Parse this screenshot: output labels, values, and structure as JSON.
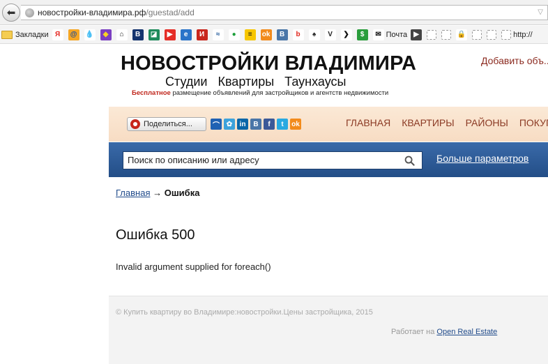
{
  "browser": {
    "url_host": "новостройки-владимира.рф",
    "url_path": "/guestad/add"
  },
  "bookmarks": {
    "folder_label": "Закладки",
    "mail_label": "Почта",
    "last_label": "http://",
    "favicons": [
      {
        "icon": "yandex-icon",
        "glyph": "Я",
        "color": "#ffffff",
        "fg": "#e52620"
      },
      {
        "icon": "mailru-icon",
        "glyph": "@",
        "color": "#f5a623",
        "fg": "#1a4c9c"
      },
      {
        "icon": "drop-icon",
        "glyph": "💧",
        "color": "#ffffff",
        "fg": "#2a7bd6"
      },
      {
        "icon": "rainbow-icon",
        "glyph": "◆",
        "color": "#7b3fc2",
        "fg": "#f9d423"
      },
      {
        "icon": "home-icon",
        "glyph": "⌂",
        "color": "#ffffff",
        "fg": "#111111"
      },
      {
        "icon": "bill-icon",
        "glyph": "B",
        "color": "#14346e",
        "fg": "#ffffff"
      },
      {
        "icon": "green-square-icon",
        "glyph": "◪",
        "color": "#1f8b5c",
        "fg": "#ffffff"
      },
      {
        "icon": "youtube-icon",
        "glyph": "▶",
        "color": "#e52d27",
        "fg": "#ffffff"
      },
      {
        "icon": "blue-app-icon",
        "glyph": "e",
        "color": "#2a74c9",
        "fg": "#ffffff"
      },
      {
        "icon": "red-app-icon",
        "glyph": "И",
        "color": "#c9261d",
        "fg": "#ffffff"
      },
      {
        "icon": "bank-icon",
        "glyph": "≈",
        "color": "#ffffff",
        "fg": "#245c9c"
      },
      {
        "icon": "sberbank-icon",
        "glyph": "●",
        "color": "#ffffff",
        "fg": "#1d9f3b"
      },
      {
        "icon": "beeline-icon",
        "glyph": "≡",
        "color": "#f7c600",
        "fg": "#111111"
      },
      {
        "icon": "odnoklassniki-icon",
        "glyph": "ok",
        "color": "#f28b1c",
        "fg": "#ffffff"
      },
      {
        "icon": "vk-icon",
        "glyph": "B",
        "color": "#4a76a8",
        "fg": "#ffffff"
      },
      {
        "icon": "badoo-icon",
        "glyph": "b",
        "color": "#ffffff",
        "fg": "#e0261c"
      },
      {
        "icon": "lamp-icon",
        "glyph": "♠",
        "color": "#ffffff",
        "fg": "#222222"
      },
      {
        "icon": "v-letter-icon",
        "glyph": "V",
        "color": "#ffffff",
        "fg": "#222222"
      },
      {
        "icon": "chevron-right-icon",
        "glyph": "❯",
        "color": "#ffffff",
        "fg": "#111111"
      },
      {
        "icon": "dollar-icon",
        "glyph": "$",
        "color": "#2a9d3c",
        "fg": "#ffffff"
      }
    ],
    "trailing": [
      {
        "icon": "play-icon",
        "glyph": "▶",
        "color": "#444444",
        "fg": "#ffffff"
      },
      {
        "icon": "blank-page-icon",
        "glyph": "",
        "color": "#ffffff",
        "fg": "#999999"
      },
      {
        "icon": "blank-page-icon",
        "glyph": "",
        "color": "#ffffff",
        "fg": "#999999"
      },
      {
        "icon": "lock-icon",
        "glyph": "🔒",
        "color": "#ffffff",
        "fg": "#e2a100"
      },
      {
        "icon": "blank-page-icon",
        "glyph": "",
        "color": "#ffffff",
        "fg": "#999999"
      },
      {
        "icon": "blank-page-icon",
        "glyph": "",
        "color": "#ffffff",
        "fg": "#999999"
      }
    ]
  },
  "site": {
    "logo_title": "НОВОСТРОЙКИ ВЛАДИМИРА",
    "logo_sub": "Студии Квартиры Таунхаусы",
    "logo_tag_red": "Бесплатное",
    "logo_tag_rest": " размещение объявлений для застройщиков и агентств недвижимости",
    "add_listing": "Добавить объ..."
  },
  "nav": {
    "share_label": "Поделиться...",
    "social": [
      {
        "icon": "bookmark-icon",
        "glyph": "⌒",
        "color": "#1f61b3"
      },
      {
        "icon": "flower-icon",
        "glyph": "✿",
        "color": "#3da2db"
      },
      {
        "icon": "linkedin-icon",
        "glyph": "in",
        "color": "#0a66a8"
      },
      {
        "icon": "vk-icon",
        "glyph": "B",
        "color": "#4a76a8"
      },
      {
        "icon": "facebook-icon",
        "glyph": "f",
        "color": "#3b5998"
      },
      {
        "icon": "twitter-icon",
        "glyph": "t",
        "color": "#29a9e1"
      },
      {
        "icon": "odnoklassniki-icon",
        "glyph": "ok",
        "color": "#f28b1c"
      }
    ],
    "links": [
      "ГЛАВНАЯ",
      "КВАРТИРЫ",
      "РАЙОНЫ",
      "ПОКУП..."
    ]
  },
  "search": {
    "placeholder": "Поиск по описанию или адресу",
    "more_params": "Больше параметров"
  },
  "breadcrumb": {
    "home": "Главная",
    "sep": " → ",
    "current": "Ошибка"
  },
  "error": {
    "title": "Ошибка 500",
    "message": "Invalid argument supplied for foreach()"
  },
  "footer": {
    "copyright": "© Купить квартиру во Владимире:новостройки.Цены застройщика, 2015",
    "powered_prefix": "Работает на ",
    "powered_link": "Open Real Estate"
  }
}
